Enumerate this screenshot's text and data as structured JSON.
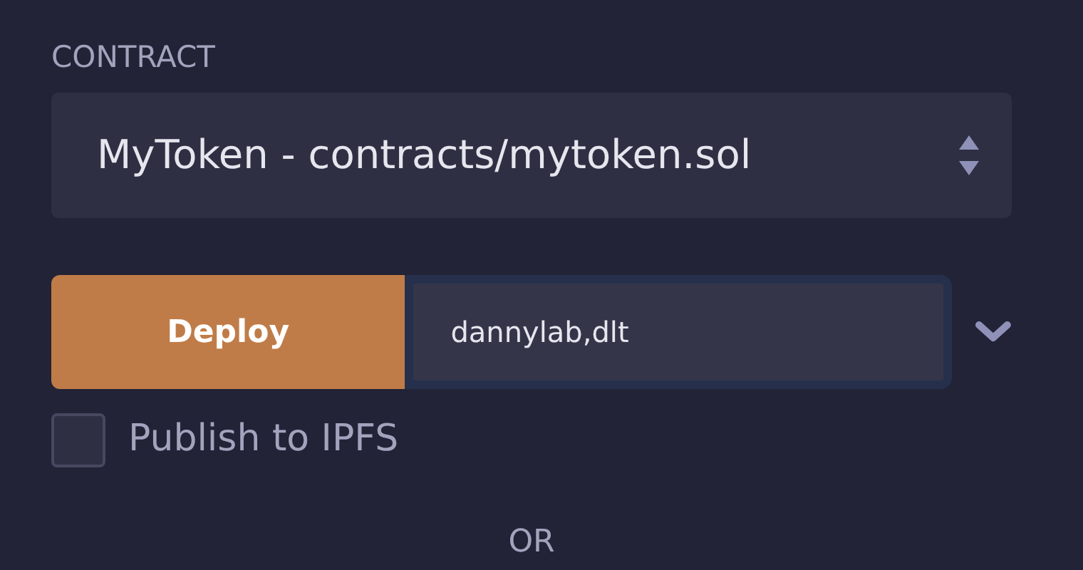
{
  "contract": {
    "label": "CONTRACT",
    "value": "MyToken - contracts/mytoken.sol"
  },
  "deploy": {
    "button": "Deploy",
    "value": "dannylab,dlt",
    "focused": true
  },
  "publish": {
    "label": "Publish to IPFS",
    "checked": false
  },
  "separator": "OR"
}
